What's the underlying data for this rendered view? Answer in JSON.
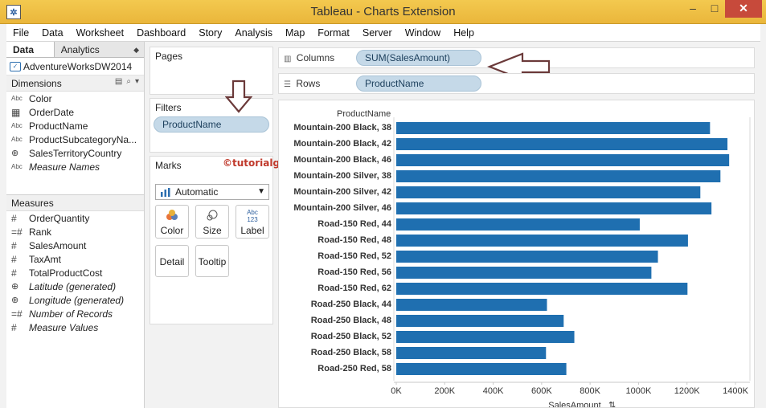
{
  "window": {
    "title": "Tableau - Charts Extension",
    "controls": {
      "minimize": "–",
      "maximize": "□",
      "close": "✕"
    }
  },
  "menu": [
    "File",
    "Data",
    "Worksheet",
    "Dashboard",
    "Story",
    "Analysis",
    "Map",
    "Format",
    "Server",
    "Window",
    "Help"
  ],
  "left_pane": {
    "tabs": {
      "data": "Data",
      "analytics": "Analytics"
    },
    "datasource": "AdventureWorksDW2014",
    "dimensions_header": "Dimensions",
    "dimensions": [
      {
        "type": "Abc",
        "name": "Color",
        "italic": false
      },
      {
        "type": "cal",
        "name": "OrderDate",
        "italic": false
      },
      {
        "type": "Abc",
        "name": "ProductName",
        "italic": false
      },
      {
        "type": "Abc",
        "name": "ProductSubcategoryNa...",
        "italic": false
      },
      {
        "type": "globe",
        "name": "SalesTerritoryCountry",
        "italic": false
      },
      {
        "type": "Abc",
        "name": "Measure Names",
        "italic": true
      }
    ],
    "measures_header": "Measures",
    "measures": [
      {
        "type": "#",
        "name": "OrderQuantity",
        "italic": false
      },
      {
        "type": "=#",
        "name": "Rank",
        "italic": false
      },
      {
        "type": "#",
        "name": "SalesAmount",
        "italic": false
      },
      {
        "type": "#",
        "name": "TaxAmt",
        "italic": false
      },
      {
        "type": "#",
        "name": "TotalProductCost",
        "italic": false
      },
      {
        "type": "globe",
        "name": "Latitude (generated)",
        "italic": true
      },
      {
        "type": "globe",
        "name": "Longitude (generated)",
        "italic": true
      },
      {
        "type": "=#",
        "name": "Number of Records",
        "italic": true
      },
      {
        "type": "#",
        "name": "Measure Values",
        "italic": true
      }
    ]
  },
  "cards": {
    "pages": "Pages",
    "filters": "Filters",
    "filter_pill": "ProductName",
    "marks": "Marks",
    "mark_type": "Automatic",
    "mark_buttons": [
      "Color",
      "Size",
      "Label",
      "Detail",
      "Tooltip"
    ],
    "label_glyph": "Abc\n123"
  },
  "shelves": {
    "columns_label": "Columns",
    "columns_pill": "SUM(SalesAmount)",
    "rows_label": "Rows",
    "rows_pill": "ProductName"
  },
  "watermark": "©tutorialgateway.org",
  "colors": {
    "bar": "#1f6fb0",
    "pill": "#c5d9e8",
    "titlebar": "#f0c14b",
    "arrow": "#6b3a3a"
  },
  "chart_data": {
    "type": "bar",
    "orientation": "horizontal",
    "row_header": "ProductName",
    "xlabel": "SalesAmount",
    "xlim": [
      0,
      1400000
    ],
    "x_ticks": [
      "0K",
      "200K",
      "400K",
      "600K",
      "800K",
      "1000K",
      "1200K",
      "1400K"
    ],
    "categories": [
      "Mountain-200 Black, 38",
      "Mountain-200 Black, 42",
      "Mountain-200 Black, 46",
      "Mountain-200 Silver, 38",
      "Mountain-200 Silver, 42",
      "Mountain-200 Silver, 46",
      "Road-150 Red, 44",
      "Road-150 Red, 48",
      "Road-150 Red, 52",
      "Road-150 Red, 56",
      "Road-150 Red, 62",
      "Road-250 Black, 44",
      "Road-250 Black, 48",
      "Road-250 Black, 52",
      "Road-250 Black, 58",
      "Road-250 Red, 58"
    ],
    "values": [
      1295000,
      1367000,
      1374000,
      1338000,
      1255000,
      1301000,
      1005000,
      1204000,
      1080000,
      1053000,
      1202000,
      622000,
      691000,
      735000,
      618000,
      702000
    ]
  }
}
